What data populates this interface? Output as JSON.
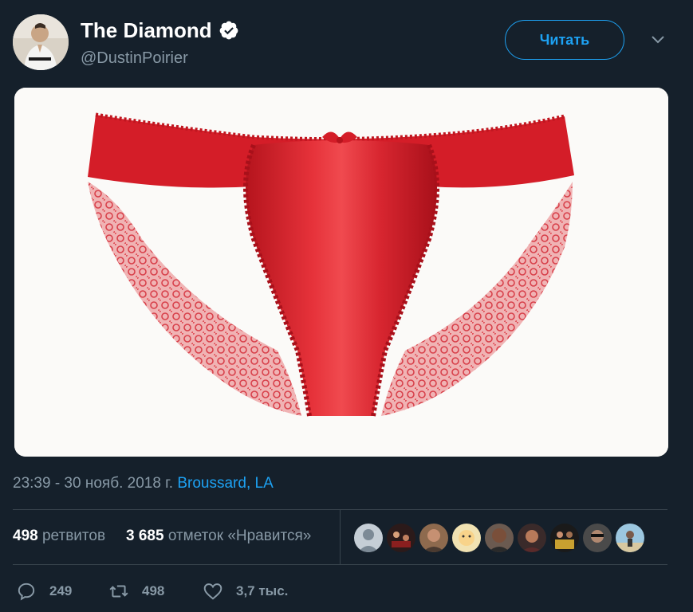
{
  "tweet": {
    "author": {
      "display_name": "The Diamond",
      "handle": "@DustinPoirier",
      "verified": true
    },
    "follow_button": {
      "label": "Читать"
    },
    "menu_icon": "chevron-down-icon",
    "timestamp": "23:39 - 30 нояб. 2018 г.",
    "location": "Broussard, LA",
    "stats": {
      "retweets_count": "498",
      "retweets_label": "ретвитов",
      "likes_count": "3 685",
      "likes_label": "отметок «Нравится»"
    },
    "likers_count_shown": 9,
    "actions": {
      "replies": "249",
      "retweets": "498",
      "likes": "3,7 тыс."
    }
  },
  "colors": {
    "background": "#15202b",
    "accent": "#1da1f2",
    "muted": "#8899a6",
    "divider": "#38444d"
  }
}
